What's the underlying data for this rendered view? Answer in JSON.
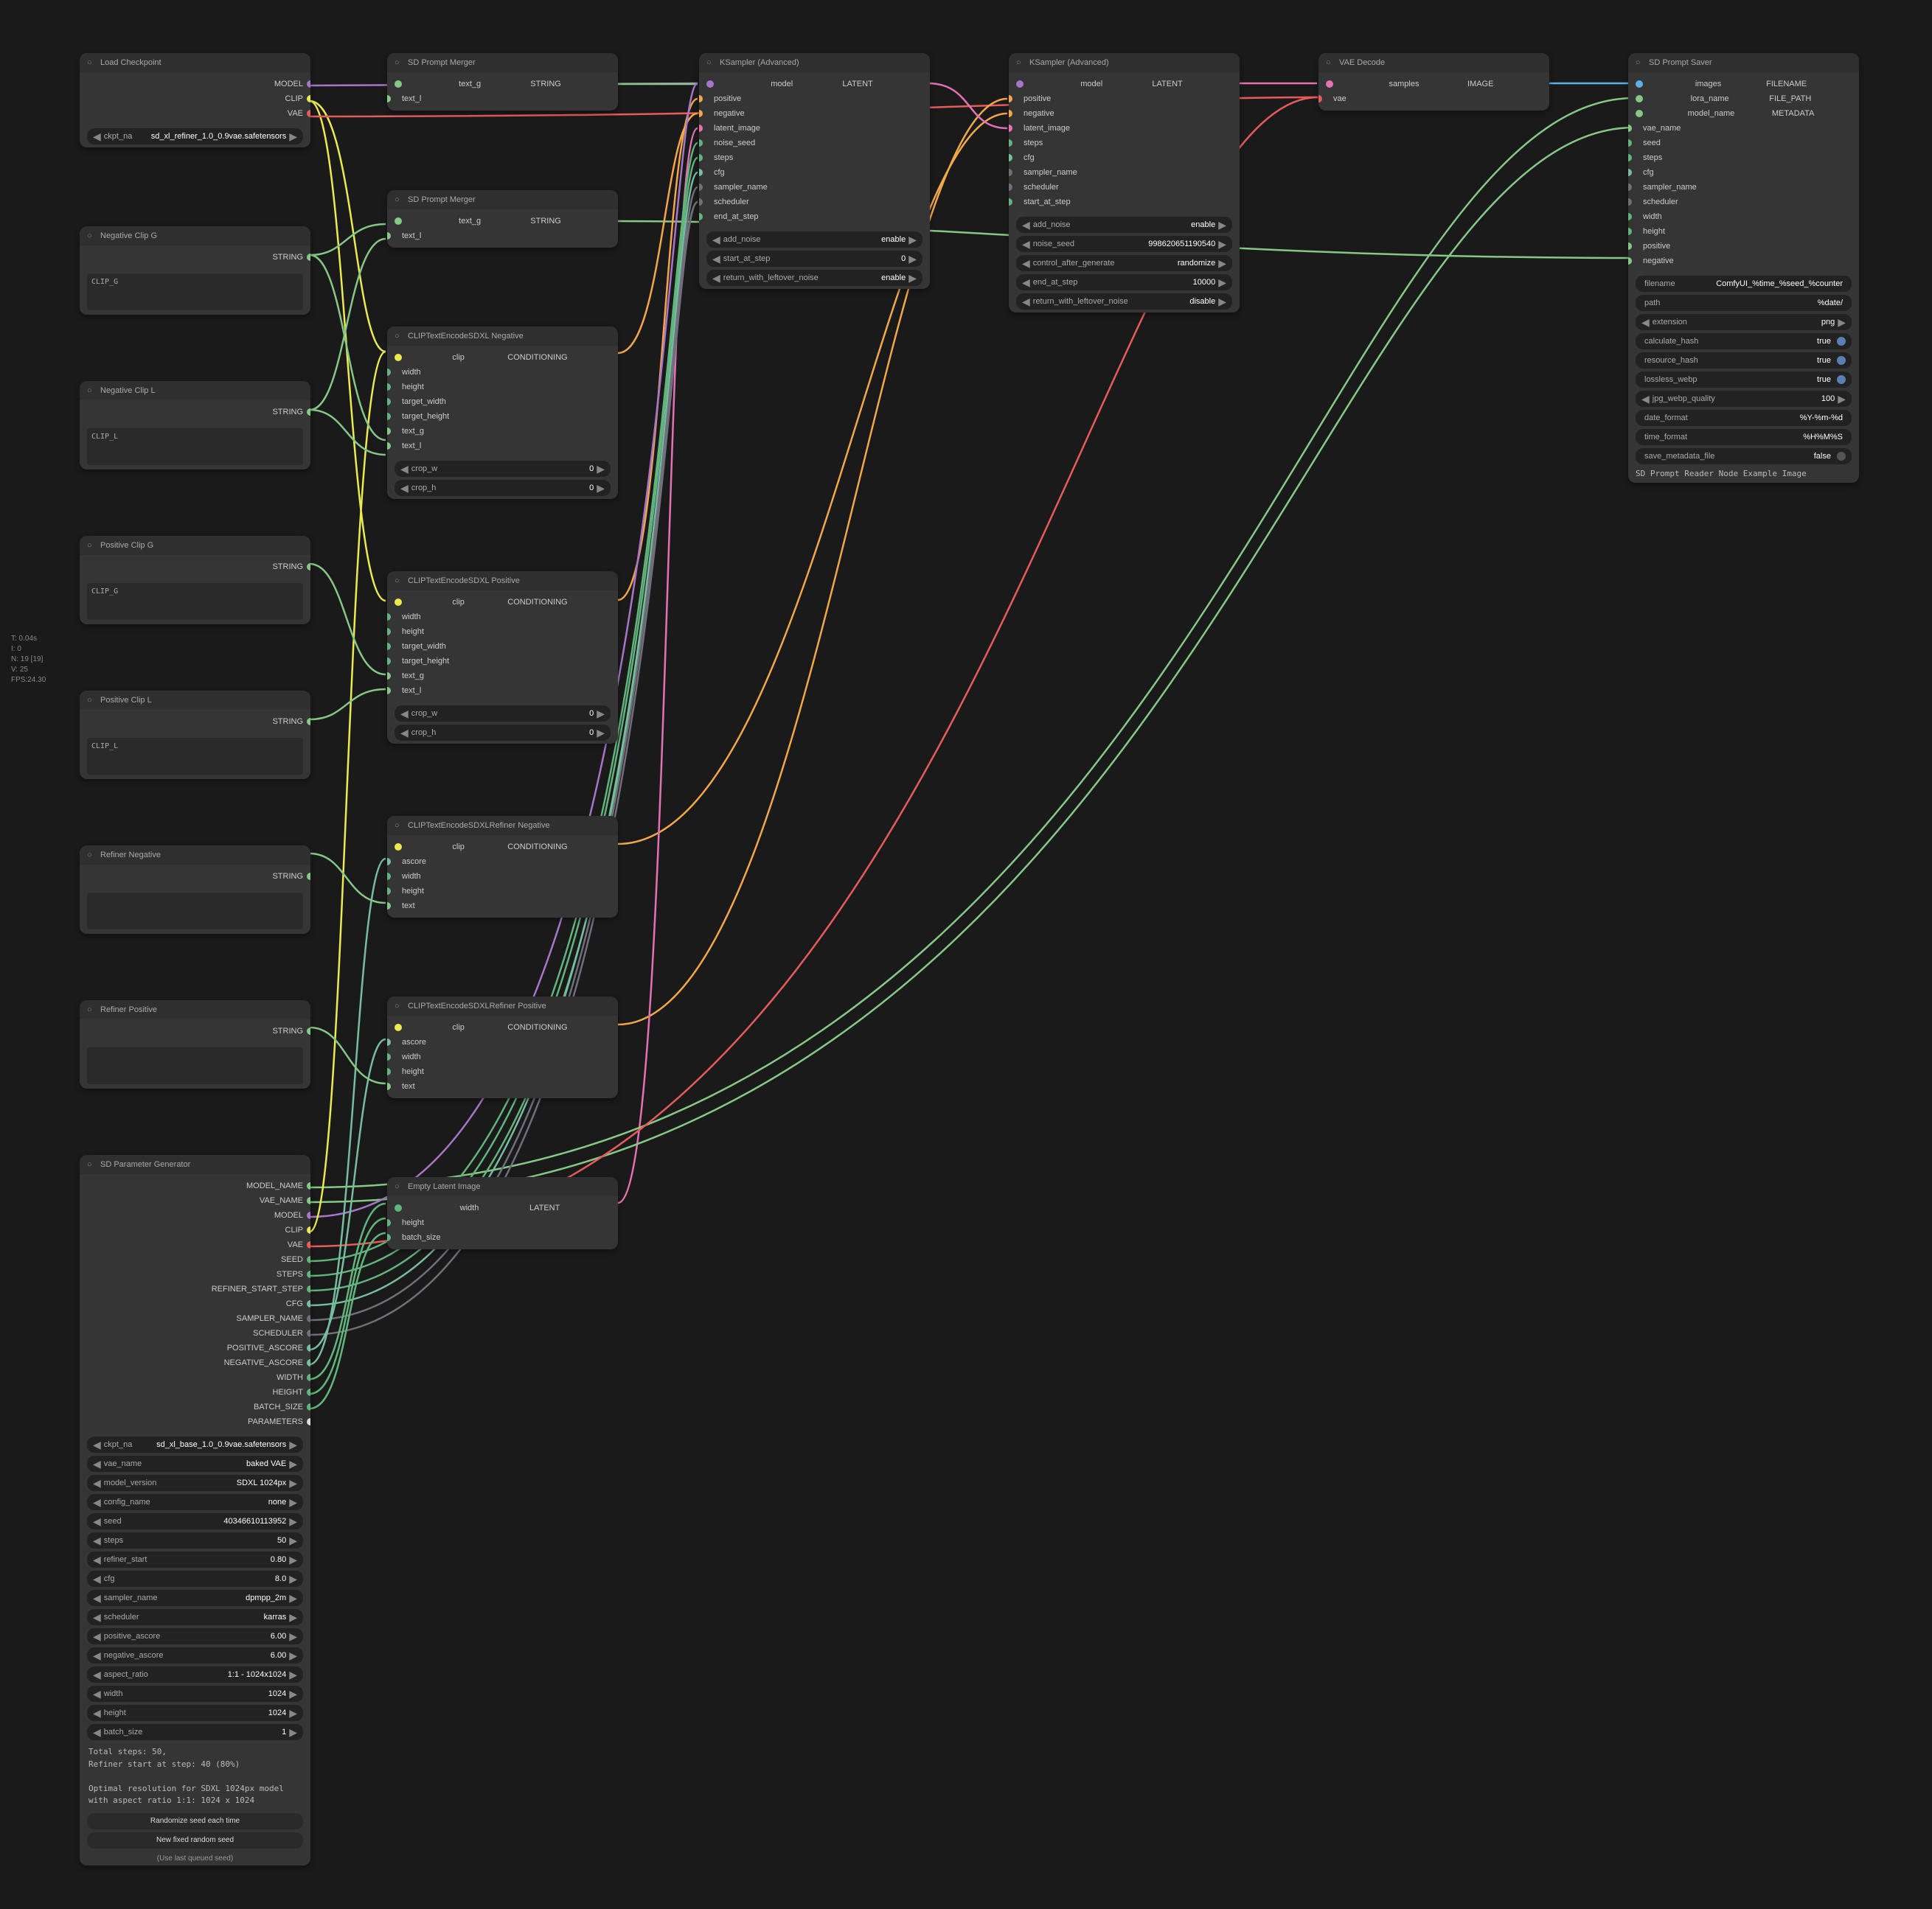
{
  "stats": {
    "l1": "T: 0.04s",
    "l2": "I: 0",
    "l3": "N: 19 [19]",
    "l4": "V: 25",
    "l5": "FPS:24.30"
  },
  "nodes": {
    "loadckpt": {
      "title": "Load Checkpoint",
      "outputs": [
        "MODEL",
        "CLIP",
        "VAE"
      ],
      "ckpt_name": "sd_xl_refiner_1.0_0.9vae.safetensors",
      "ckpt_label": "ckpt_na"
    },
    "negg": {
      "title": "Negative Clip G",
      "output": "STRING",
      "text": "CLIP_G"
    },
    "negl": {
      "title": "Negative Clip L",
      "output": "STRING",
      "text": "CLIP_L"
    },
    "posg": {
      "title": "Positive Clip G",
      "output": "STRING",
      "text": "CLIP_G"
    },
    "posl": {
      "title": "Positive Clip L",
      "output": "STRING",
      "text": "CLIP_L"
    },
    "refneg": {
      "title": "Refiner Negative",
      "output": "STRING"
    },
    "refpos": {
      "title": "Refiner Positive",
      "output": "STRING"
    },
    "merger1": {
      "title": "SD Prompt Merger",
      "inputs": [
        "text_g",
        "text_l"
      ],
      "output": "STRING"
    },
    "merger2": {
      "title": "SD Prompt Merger",
      "inputs": [
        "text_g",
        "text_l"
      ],
      "output": "STRING"
    },
    "clipneg": {
      "title": "CLIPTextEncodeSDXL Negative",
      "inputs": [
        "clip",
        "width",
        "height",
        "target_width",
        "target_height",
        "text_g",
        "text_l"
      ],
      "output": "CONDITIONING",
      "crop_w_label": "crop_w",
      "crop_w": "0",
      "crop_h_label": "crop_h",
      "crop_h": "0"
    },
    "clippos": {
      "title": "CLIPTextEncodeSDXL Positive",
      "inputs": [
        "clip",
        "width",
        "height",
        "target_width",
        "target_height",
        "text_g",
        "text_l"
      ],
      "output": "CONDITIONING",
      "crop_w_label": "crop_w",
      "crop_w": "0",
      "crop_h_label": "crop_h",
      "crop_h": "0"
    },
    "cliprefneg": {
      "title": "CLIPTextEncodeSDXLRefiner Negative",
      "inputs": [
        "clip",
        "ascore",
        "width",
        "height",
        "text"
      ],
      "output": "CONDITIONING"
    },
    "cliprefpos": {
      "title": "CLIPTextEncodeSDXLRefiner Positive",
      "inputs": [
        "clip",
        "ascore",
        "width",
        "height",
        "text"
      ],
      "output": "CONDITIONING"
    },
    "empty": {
      "title": "Empty Latent Image",
      "inputs": [
        "width",
        "height",
        "batch_size"
      ],
      "output": "LATENT"
    },
    "ksamp1": {
      "title": "KSampler (Advanced)",
      "inputs": [
        "model",
        "positive",
        "negative",
        "latent_image",
        "noise_seed",
        "steps",
        "cfg",
        "sampler_name",
        "scheduler",
        "end_at_step"
      ],
      "output": "LATENT",
      "add_noise_label": "add_noise",
      "add_noise": "enable",
      "start_label": "start_at_step",
      "start": "0",
      "leftover_label": "return_with_leftover_noise",
      "leftover": "enable"
    },
    "ksamp2": {
      "title": "KSampler (Advanced)",
      "inputs": [
        "model",
        "positive",
        "negative",
        "latent_image",
        "steps",
        "cfg",
        "sampler_name",
        "scheduler",
        "start_at_step"
      ],
      "output": "LATENT",
      "add_noise_label": "add_noise",
      "add_noise": "enable",
      "seed_label": "noise_seed",
      "seed": "998620651190540",
      "ctrl_label": "control_after_generate",
      "ctrl": "randomize",
      "end_label": "end_at_step",
      "end": "10000",
      "leftover_label": "return_with_leftover_noise",
      "leftover": "disable"
    },
    "vaedec": {
      "title": "VAE Decode",
      "inputs": [
        "samples",
        "vae"
      ],
      "output": "IMAGE"
    },
    "saver": {
      "title": "SD Prompt Saver",
      "inputs": [
        "images",
        "lora_name",
        "model_name",
        "vae_name",
        "seed",
        "steps",
        "cfg",
        "sampler_name",
        "scheduler",
        "width",
        "height",
        "positive",
        "negative"
      ],
      "outputs": [
        "FILENAME",
        "FILE_PATH",
        "METADATA"
      ],
      "filename_label": "filename",
      "filename": "ComfyUI_%time_%seed_%counter",
      "path_label": "path",
      "path": "%date/",
      "ext_label": "extension",
      "ext": "png",
      "hash_label": "calculate_hash",
      "hash": "true",
      "reshash_label": "resource_hash",
      "reshash": "true",
      "lossless_label": "lossless_webp",
      "lossless": "true",
      "quality_label": "jpg_webp_quality",
      "quality": "100",
      "datefmt_label": "date_format",
      "datefmt": "%Y-%m-%d",
      "timefmt_label": "time_format",
      "timefmt": "%H%M%S",
      "savemeta_label": "save_metadata_file",
      "savemeta": "false",
      "preview": "SD Prompt Reader Node Example Image"
    },
    "paramgen": {
      "title": "SD Parameter Generator",
      "outputs": [
        "MODEL_NAME",
        "VAE_NAME",
        "MODEL",
        "CLIP",
        "VAE",
        "SEED",
        "STEPS",
        "REFINER_START_STEP",
        "CFG",
        "SAMPLER_NAME",
        "SCHEDULER",
        "POSITIVE_ASCORE",
        "NEGATIVE_ASCORE",
        "WIDTH",
        "HEIGHT",
        "BATCH_SIZE",
        "PARAMETERS"
      ],
      "ckpt_label": "ckpt_na",
      "ckpt": "sd_xl_base_1.0_0.9vae.safetensors",
      "vaename_label": "vae_name",
      "vaename": "baked VAE",
      "mver_label": "model_version",
      "mver": "SDXL 1024px",
      "cfgname_label": "config_name",
      "cfgname": "none",
      "seed_label": "seed",
      "seed": "40346610113952",
      "steps_label": "steps",
      "steps": "50",
      "refstart_label": "refiner_start",
      "refstart": "0.80",
      "cfg_label": "cfg",
      "cfg": "8.0",
      "sampler_label": "sampler_name",
      "sampler": "dpmpp_2m",
      "sched_label": "scheduler",
      "sched": "karras",
      "pas_label": "positive_ascore",
      "pas": "6.00",
      "nas_label": "negative_ascore",
      "nas": "6.00",
      "aspect_label": "aspect_ratio",
      "aspect": "1:1 - 1024x1024",
      "width_label": "width",
      "width": "1024",
      "height_label": "height",
      "height": "1024",
      "batch_label": "batch_size",
      "batch": "1",
      "info": "Total steps: 50,\nRefiner start at step: 40 (80%)\n\nOptimal resolution for SDXL 1024px model\nwith aspect ratio 1:1: 1024 x 1024",
      "btn1": "Randomize seed each time",
      "btn2": "New fixed random seed",
      "link": "(Use last queued seed)"
    }
  },
  "colors": {
    "model": "#a876c9",
    "clip": "#ecea50",
    "vae": "#e85b5b",
    "string": "#86c886",
    "cond": "#f2a848",
    "latent": "#e472b4",
    "image": "#5cb0e8",
    "int": "#62b57c",
    "float": "#78bda1",
    "combo": "#70707c",
    "params": "#ddd"
  }
}
